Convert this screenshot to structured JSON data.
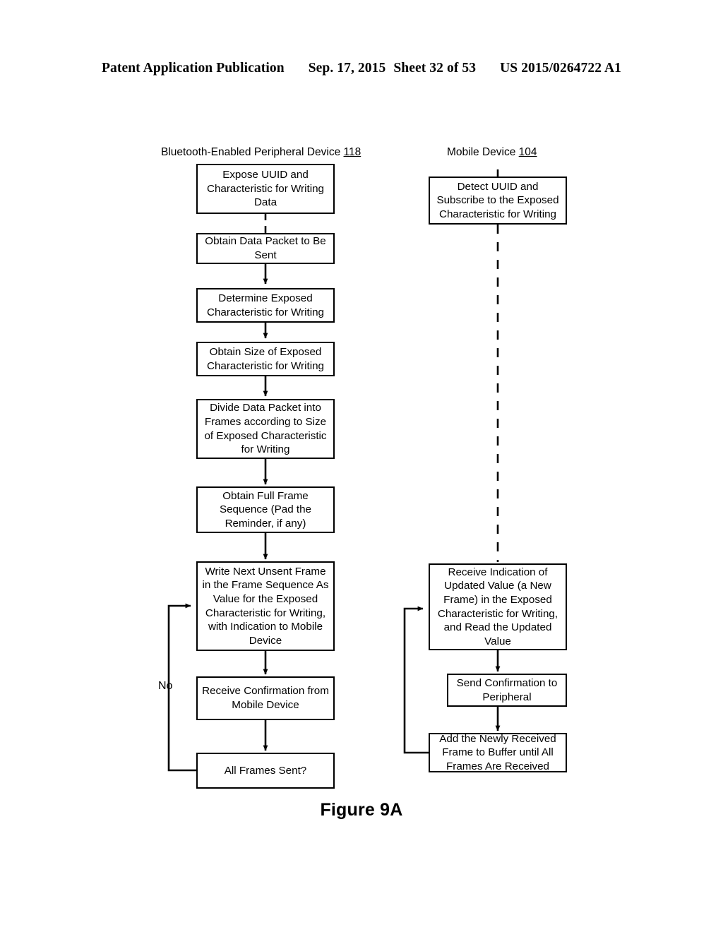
{
  "header": {
    "publication": "Patent Application Publication",
    "date": "Sep. 17, 2015",
    "sheet": "Sheet 32 of 53",
    "patent_number": "US 2015/0264722 A1"
  },
  "figure": {
    "caption": "Figure 9A",
    "type": "flowchart",
    "columns": [
      {
        "id": "peripheral",
        "title_text": "Bluetooth-Enabled Peripheral Device ",
        "title_ref": "118"
      },
      {
        "id": "mobile",
        "title_text": "Mobile Device ",
        "title_ref": "104"
      }
    ],
    "left_nodes": [
      {
        "id": "expose-uuid",
        "label": "Expose UUID and\nCharacteristic for Writing\nData"
      },
      {
        "id": "obtain-packet",
        "label": "Obtain Data Packet to Be\nSent"
      },
      {
        "id": "determine-char",
        "label": "Determine Exposed\nCharacteristic for Writing"
      },
      {
        "id": "obtain-size",
        "label": "Obtain Size of Exposed\nCharacteristic for Writing"
      },
      {
        "id": "divide-packet",
        "label": "Divide Data Packet into\nFrames according to Size\nof Exposed Characteristic\nfor Writing"
      },
      {
        "id": "obtain-sequence",
        "label": "Obtain Full Frame\nSequence (Pad the\nReminder, if any)"
      },
      {
        "id": "write-frame",
        "label": "Write Next Unsent Frame\nin the Frame Sequence As\nValue for the Exposed\nCharacteristic for Writing,\nwith Indication to Mobile\nDevice"
      },
      {
        "id": "receive-confirm",
        "label": "Receive Confirmation from\nMobile Device"
      },
      {
        "id": "all-frames-sent",
        "label": "All Frames Sent?"
      }
    ],
    "right_nodes": [
      {
        "id": "detect-uuid",
        "label": "Detect UUID and\nSubscribe to the Exposed\nCharacteristic for Writing"
      },
      {
        "id": "receive-indication",
        "label": "Receive Indication of\nUpdated Value (a New\nFrame) in the Exposed\nCharacteristic for Writing,\nand  Read the Updated\nValue"
      },
      {
        "id": "send-confirm",
        "label": "Send Confirmation to\nPeripheral"
      },
      {
        "id": "add-frame-buffer",
        "label": "Add the Newly Received\nFrame to Buffer until All\nFrames Are Received"
      }
    ],
    "loop_labels": [
      {
        "id": "no-branch",
        "label": "No"
      }
    ]
  }
}
